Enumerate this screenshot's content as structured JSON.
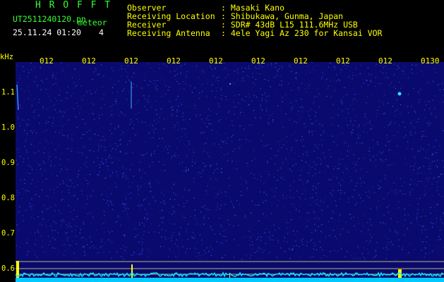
{
  "app": {
    "name": "H R O F F T",
    "filename": "UT2511240120.pn",
    "detector": "meteor",
    "datetime": "25.11.24 01:20",
    "count": "4"
  },
  "station": {
    "labels": [
      "Observer",
      "Receiving Location",
      "Receiver",
      "Receiving Antenna"
    ],
    "values": [
      ": Masaki Kano",
      ": Shibukawa, Gunma, Japan",
      ": SDR# 43dB L15 111.6MHz USB",
      ": 4ele Yagi Az 230 for Kansai VOR"
    ]
  },
  "axis": {
    "unit": "kHz",
    "y_ticks": [
      "1.1",
      "1.0",
      "0.9",
      "0.8",
      "0.7",
      "0.6"
    ],
    "time_ticks": [
      "012",
      "012",
      "012",
      "012",
      "012",
      "012",
      "012",
      "012",
      "012",
      "0130"
    ]
  },
  "colors": {
    "background": "#000000",
    "waterfall": "#0a0a6e",
    "signal": "#00e5ff",
    "grid": "#ffff00",
    "title": "#33ff33",
    "text": "#ffff00"
  }
}
